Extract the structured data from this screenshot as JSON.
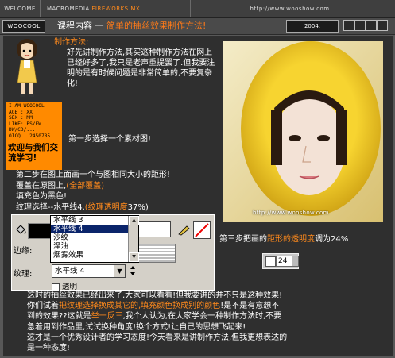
{
  "topbar": {
    "welcome": "WELCOME",
    "macromedia": "MACROMEDIA",
    "fireworks": "FIREWORKS MX",
    "url": "http://www.wooshow.com"
  },
  "titlebar": {
    "logo": "WOOCOOL",
    "course_label": "课程内容 一",
    "title": "简单的抽丝效果制作方法!",
    "year": "2004."
  },
  "intro": {
    "method_label": "制作方法:",
    "text": "好先讲制作方法,其实这种制作方法在网上已经好多了,我只是老声重提罢了.但我要注明的是有时候问题是非常简单的,不要复杂化!"
  },
  "profile": {
    "info_lines": [
      "I AM WOOCOOL",
      "AGE : XX",
      "SEX : MM",
      "LIKE: PS/FW",
      "DW/CD/...",
      "OICQ : 2450785"
    ],
    "welcome": "欢迎与我们交流学习!"
  },
  "steps": {
    "step1": "第一步选择一个素材图!",
    "step2_line1": "第二步在图上面画一个与图相同大小的距形!",
    "step2_line2a": "覆盖在原图上,",
    "step2_line2b": "(全部覆盖)",
    "step2_line3": "填充色为黑色!",
    "step2_line4a": "纹理选择--水平线4.",
    "step2_line4b": "(纹理透明度",
    "step2_line4c": "37%)",
    "step3_a": "第三步把画的",
    "step3_b": "距形的透明度",
    "step3_c": "调为24%"
  },
  "photo": {
    "watermark": "http://www.wooshow.com"
  },
  "spinner": {
    "value": "24"
  },
  "fireworks_panel": {
    "edge_label": "边缘:",
    "texture_label": "纹理:",
    "texture_value": "水平线 4",
    "transparent_label": "透明",
    "dropdown_items": [
      "水平线 3",
      "水平线 4",
      "沙纹",
      "泽油",
      "烟雾效果"
    ],
    "dropdown_selected_index": 1
  },
  "conclusion": {
    "p1": "这时的抽丝效果已经出来了,大家可以看看!但我要讲的并不只是这种效果!",
    "p2a": "你们试着",
    "p2b": "把纹理选择换成其它的,填充颜色换成别的颜色",
    "p2c": "!是不是有意想不",
    "p3a": "到的效果??这就是",
    "p3b": "举一反三",
    "p3c": ",我个人认为,在大家学会一种制作方法时,不要",
    "p4": "急着用到作品里,试试换种角度!换个方式!让自己的思想飞起来!",
    "p5": "这才是一个优秀设计者的学习态度!今天看来是讲制作方法,但我更想表达的",
    "p6": "是一种态度!"
  },
  "colors": {
    "accent": "#ff8a1c",
    "panel": "#2f2f2f",
    "frame": "#585858"
  }
}
